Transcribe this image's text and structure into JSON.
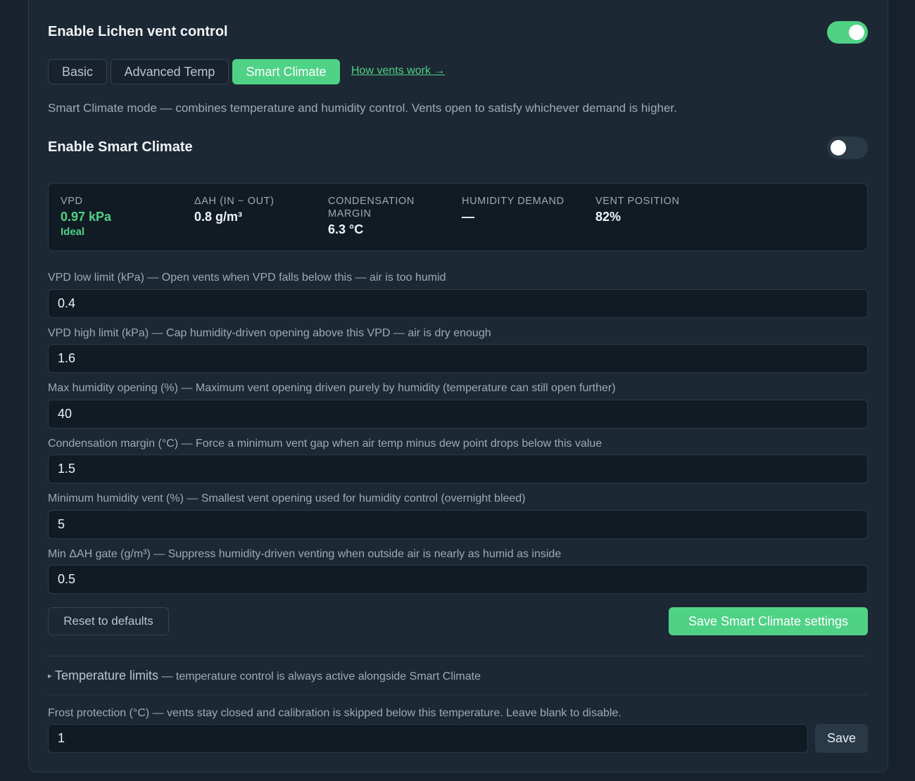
{
  "header": {
    "title": "Enable Lichen vent control",
    "toggle_on": true
  },
  "tabs": [
    {
      "label": "Basic",
      "active": false
    },
    {
      "label": "Advanced Temp",
      "active": false
    },
    {
      "label": "Smart Climate",
      "active": true
    }
  ],
  "help_link": "How vents work →",
  "mode_description": "Smart Climate mode — combines temperature and humidity control. Vents open to satisfy whichever demand is higher.",
  "smart_climate": {
    "title": "Enable Smart Climate",
    "toggle_on": false
  },
  "stats": [
    {
      "label": "VPD",
      "value": "0.97 kPa",
      "sub": "Ideal"
    },
    {
      "label": "ΔAH (in − out)",
      "value": "0.8 g/m³"
    },
    {
      "label": "Condensation margin",
      "value": "6.3 °C"
    },
    {
      "label": "Humidity demand",
      "value": "—"
    },
    {
      "label": "Vent position",
      "value": "82%"
    }
  ],
  "fields": [
    {
      "label": "VPD low limit (kPa) — Open vents when VPD falls below this — air is too humid",
      "value": "0.4"
    },
    {
      "label": "VPD high limit (kPa) — Cap humidity-driven opening above this VPD — air is dry enough",
      "value": "1.6"
    },
    {
      "label": "Max humidity opening (%) — Maximum vent opening driven purely by humidity (temperature can still open further)",
      "value": "40"
    },
    {
      "label": "Condensation margin (°C) — Force a minimum vent gap when air temp minus dew point drops below this value",
      "value": "1.5"
    },
    {
      "label": "Minimum humidity vent (%) — Smallest vent opening used for humidity control (overnight bleed)",
      "value": "5"
    },
    {
      "label": "Min ΔAH gate (g/m³) — Suppress humidity-driven venting when outside air is nearly as humid as inside",
      "value": "0.5"
    }
  ],
  "buttons": {
    "reset": "Reset to defaults",
    "save_smart": "Save Smart Climate settings",
    "save_frost": "Save"
  },
  "temperature_limits": {
    "arrow": "▸",
    "title": "Temperature limits",
    "note": "— temperature control is always active alongside Smart Climate"
  },
  "frost": {
    "label": "Frost protection (°C) — vents stay closed and calibration is skipped below this temperature. Leave blank to disable.",
    "value": "1"
  },
  "colors": {
    "accent": "#4fd286",
    "background": "#17222c",
    "card": "#1c2833"
  }
}
